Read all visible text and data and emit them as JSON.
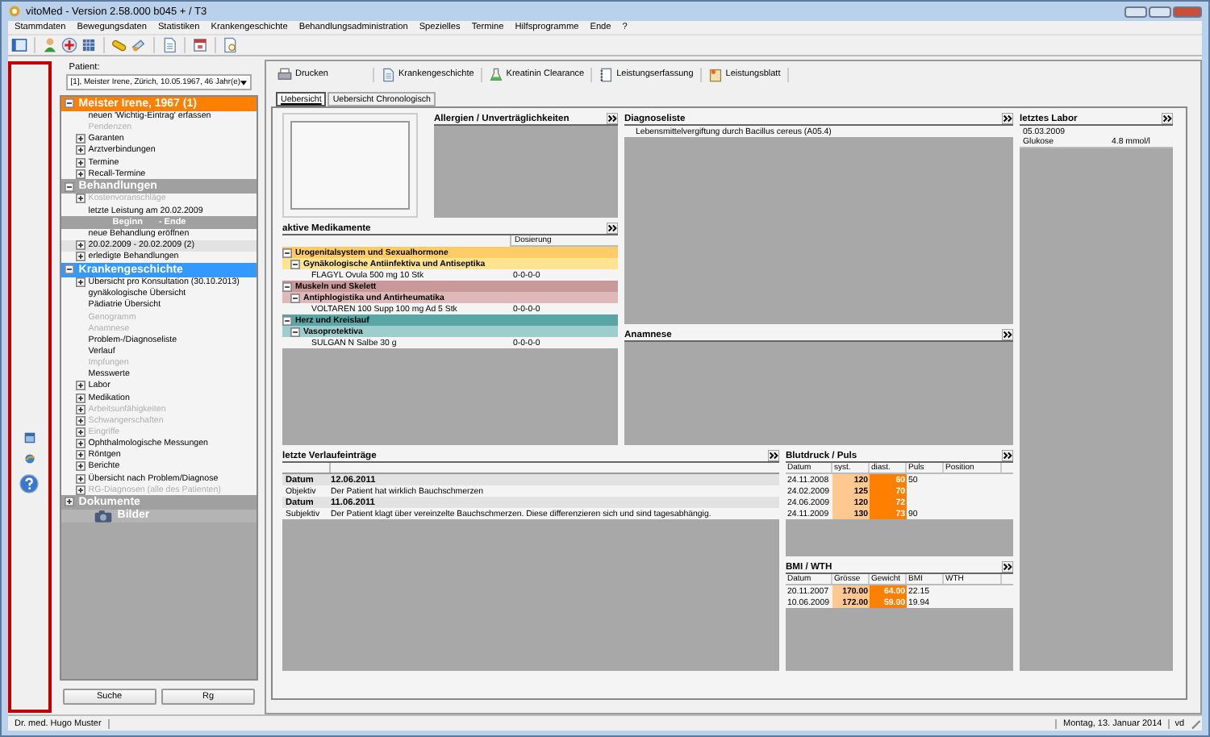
{
  "window": {
    "title": "vitoMed  -  Version 2.58.000 b045 + / T3"
  },
  "menu": [
    "Stammdaten",
    "Bewegungsdaten",
    "Statistiken",
    "Krankengeschichte",
    "Behandlungsadministration",
    "Spezielles",
    "Termine",
    "Hilfsprogramme",
    "Ende",
    "?"
  ],
  "patient": {
    "label": "Patient:",
    "value": "[1], Meister Irene, Zürich, 10.05.1967, 46 Jahr(e)"
  },
  "tree": [
    {
      "kind": "section",
      "label": "Meister Irene, 1967 (1)",
      "color": "#ff8000",
      "expanded": true,
      "items": [
        {
          "kind": "item",
          "label": "neuen 'Wichtig-Eintrag' erfassen",
          "expandable": false,
          "disabled": false,
          "selected": false
        },
        {
          "kind": "item",
          "label": "Pendenzen",
          "expandable": false,
          "disabled": true,
          "selected": false
        },
        {
          "kind": "item",
          "label": "Garanten",
          "expandable": true,
          "disabled": false,
          "selected": false
        },
        {
          "kind": "item",
          "label": "Arztverbindungen",
          "expandable": true,
          "disabled": false,
          "selected": false
        },
        {
          "kind": "item",
          "label": "Termine",
          "expandable": true,
          "disabled": false,
          "selected": false
        },
        {
          "kind": "item",
          "label": "Recall-Termine",
          "expandable": true,
          "disabled": false,
          "selected": false
        }
      ]
    },
    {
      "kind": "section",
      "label": "Behandlungen",
      "color": "#a0a0a0",
      "expanded": true,
      "items": [
        {
          "kind": "item",
          "label": "Kostenvoranschläge",
          "expandable": true,
          "disabled": true,
          "selected": false
        },
        {
          "kind": "item",
          "label": "letzte Leistung am 20.02.2009",
          "expandable": false,
          "disabled": false,
          "selected": false
        },
        {
          "kind": "columns",
          "labels": [
            "Beginn",
            "- Ende"
          ]
        },
        {
          "kind": "item",
          "label": "neue Behandlung eröffnen",
          "expandable": false,
          "disabled": false,
          "selected": false
        },
        {
          "kind": "item",
          "label": "20.02.2009 - 20.02.2009  (2)",
          "expandable": true,
          "disabled": false,
          "selected": true
        },
        {
          "kind": "item",
          "label": "erledigte Behandlungen",
          "expandable": true,
          "disabled": false,
          "selected": false
        }
      ]
    },
    {
      "kind": "section",
      "label": "Krankengeschichte",
      "color": "#3399ff",
      "expanded": true,
      "items": [
        {
          "kind": "item",
          "label": "Übersicht pro Konsultation (30.10.2013)",
          "expandable": true,
          "disabled": false,
          "selected": false
        },
        {
          "kind": "item",
          "label": "gynäkologische Übersicht",
          "expandable": false,
          "disabled": false,
          "selected": false
        },
        {
          "kind": "item",
          "label": "Pädiatrie Übersicht",
          "expandable": false,
          "disabled": false,
          "selected": false
        },
        {
          "kind": "item",
          "label": "Genogramm",
          "expandable": false,
          "disabled": true,
          "selected": false
        },
        {
          "kind": "item",
          "label": "Anamnese",
          "expandable": false,
          "disabled": true,
          "selected": false
        },
        {
          "kind": "item",
          "label": "Problem-/Diagnoseliste",
          "expandable": false,
          "disabled": false,
          "selected": false
        },
        {
          "kind": "item",
          "label": "Verlauf",
          "expandable": false,
          "disabled": false,
          "selected": false
        },
        {
          "kind": "item",
          "label": "Impfungen",
          "expandable": false,
          "disabled": true,
          "selected": false
        },
        {
          "kind": "item",
          "label": "Messwerte",
          "expandable": false,
          "disabled": false,
          "selected": false
        },
        {
          "kind": "item",
          "label": "Labor",
          "expandable": true,
          "disabled": false,
          "selected": false
        },
        {
          "kind": "item",
          "label": "Medikation",
          "expandable": true,
          "disabled": false,
          "selected": false
        },
        {
          "kind": "item",
          "label": "Arbeitsunfähigkeiten",
          "expandable": true,
          "disabled": true,
          "selected": false
        },
        {
          "kind": "item",
          "label": "Schwangerschaften",
          "expandable": true,
          "disabled": true,
          "selected": false
        },
        {
          "kind": "item",
          "label": "Eingriffe",
          "expandable": true,
          "disabled": true,
          "selected": false
        },
        {
          "kind": "item",
          "label": "Ophthalmologische Messungen",
          "expandable": true,
          "disabled": false,
          "selected": false
        },
        {
          "kind": "item",
          "label": "Röntgen",
          "expandable": true,
          "disabled": false,
          "selected": false
        },
        {
          "kind": "item",
          "label": "Berichte",
          "expandable": true,
          "disabled": false,
          "selected": false
        },
        {
          "kind": "item",
          "label": "Übersicht nach Problem/Diagnose",
          "expandable": true,
          "disabled": false,
          "selected": false
        },
        {
          "kind": "item",
          "label": "RG-Diagnosen (alle des Patienten)",
          "expandable": true,
          "disabled": true,
          "selected": false
        }
      ]
    },
    {
      "kind": "section",
      "label": "Dokumente",
      "color": "#a0a0a0",
      "expanded": false
    },
    {
      "kind": "gallery",
      "label": "Bilder",
      "color": "#b4b4b4"
    }
  ],
  "tree_buttons": [
    "Suche",
    "Rg"
  ],
  "actions": [
    "Drucken",
    "Krankengeschichte",
    "Kreatinin Clearance",
    "Leistungserfassung",
    "Leistungsblatt"
  ],
  "tabs": [
    {
      "label": "Uebersicht",
      "selected": true
    },
    {
      "label": "Uebersicht Chronologisch",
      "selected": false
    }
  ],
  "allergies": {
    "title": "Allergien / Unverträglichkeiten"
  },
  "medications": {
    "title": "aktive Medikamente",
    "dose_header": "Dosierung",
    "groups": [
      {
        "label": "Urogenitalsystem und Sexualhormone",
        "color": "#ffcc66",
        "children": [
          {
            "label": "Gynäkologische Antiinfektiva und Antiseptika",
            "color": "#ffe390",
            "children": [
              {
                "label": "FLAGYL Ovula 500 mg 10 Stk",
                "dose": "0-0-0-0"
              }
            ]
          }
        ]
      },
      {
        "label": "Muskeln und Skelett",
        "color": "#c99898",
        "children": [
          {
            "label": "Antiphlogistika und Antirheumatika",
            "color": "#dfb9b9",
            "children": [
              {
                "label": "VOLTAREN 100 Supp 100 mg Ad 5 Stk",
                "dose": "0-0-0-0"
              }
            ]
          }
        ]
      },
      {
        "label": "Herz und Kreislauf",
        "color": "#5aa6a6",
        "children": [
          {
            "label": "Vasoprotektiva",
            "color": "#9dcdcd",
            "children": [
              {
                "label": "SULGAN N Salbe 30 g",
                "dose": "0-0-0-0"
              }
            ]
          }
        ]
      }
    ]
  },
  "diagnoses": {
    "title": "Diagnoseliste",
    "items": [
      "Lebensmittelvergiftung durch Bacillus cereus (A05.4)"
    ]
  },
  "anamnesis": {
    "title": "Anamnese"
  },
  "lab": {
    "title": "letztes Labor",
    "date": "05.03.2009",
    "results": [
      {
        "name": "Glukose",
        "value": "4.8 mmol/l"
      }
    ]
  },
  "progress": {
    "title": "letzte Verlaufeinträge",
    "rows": [
      {
        "kind": "date",
        "label": "Datum",
        "value": "12.06.2011"
      },
      {
        "kind": "entry",
        "label": "Objektiv",
        "value": "Der Patient hat wirklich Bauchschmerzen"
      },
      {
        "kind": "date",
        "label": "Datum",
        "value": "11.06.2011"
      },
      {
        "kind": "entry",
        "label": "Subjektiv",
        "value": "Der Patient klagt über vereinzelte Bauchschmerzen. Diese differenzieren sich und sind tagesabhängig."
      }
    ]
  },
  "blood_pressure": {
    "title": "Blutdruck / Puls",
    "columns": [
      {
        "label": "Datum",
        "kind": "plain"
      },
      {
        "label": "syst.",
        "kind": "light"
      },
      {
        "label": "diast.",
        "kind": "strong"
      },
      {
        "label": "Puls",
        "kind": "plain"
      },
      {
        "label": "Position",
        "kind": "plain"
      }
    ],
    "rows": [
      [
        "24.11.2008",
        "120",
        "60",
        "50"
      ],
      [
        "24.02.2009",
        "125",
        "70"
      ],
      [
        "24.06.2009",
        "120",
        "72"
      ],
      [
        "24.11.2009",
        "130",
        "73",
        "90"
      ]
    ]
  },
  "bmi": {
    "title": "BMI / WTH",
    "columns": [
      {
        "label": "Datum",
        "kind": "plain"
      },
      {
        "label": "Grösse",
        "kind": "light"
      },
      {
        "label": "Gewicht",
        "kind": "strong"
      },
      {
        "label": "BMI",
        "kind": "plain"
      },
      {
        "label": "WTH",
        "kind": "plain"
      }
    ],
    "rows": [
      [
        "20.11.2007",
        "170.00",
        "64.00",
        "22.15"
      ],
      [
        "10.06.2009",
        "172.00",
        "59.00",
        "19.94"
      ]
    ]
  },
  "status": {
    "user": "Dr. med. Hugo Muster",
    "date": "Montag, 13. Januar 2014",
    "code": "vd"
  }
}
